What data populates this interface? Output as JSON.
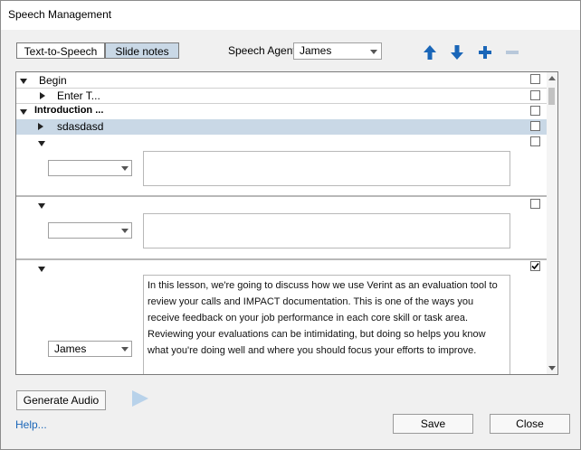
{
  "window": {
    "title": "Speech Management"
  },
  "mode_tabs": [
    {
      "label": "Text-to-Speech"
    },
    {
      "label": "Slide notes",
      "selected": true
    }
  ],
  "speech_agent": {
    "label": "Speech Agent",
    "value": "James"
  },
  "toolbar": {
    "icons": [
      "arrow-up-icon",
      "arrow-down-icon",
      "plus-icon",
      "minus-icon"
    ]
  },
  "tree": {
    "begin": {
      "label": "Begin"
    },
    "enter": {
      "label": "Enter T..."
    },
    "intro": {
      "label": "Introduction ..."
    },
    "selected": {
      "label": "sdasdasd"
    }
  },
  "notes": [
    {
      "agent": "",
      "text": "",
      "checked": false
    },
    {
      "agent": "",
      "text": "",
      "checked": false
    },
    {
      "agent": "James",
      "text": "In this lesson, we're going to discuss how we use Verint as an evaluation tool to review your calls and IMPACT documentation. This is one of the ways you receive feedback on your job performance in each core skill or task area. Reviewing your evaluations can be intimidating, but doing so helps you know what you're doing well and where you should focus your efforts to improve.",
      "checked": true
    }
  ],
  "footer": {
    "generate_label": "Generate Audio",
    "help_label": "Help...",
    "save_label": "Save",
    "close_label": "Close"
  },
  "colors": {
    "accent": "#1a66b8",
    "selected_row": "#c9d8e6"
  }
}
